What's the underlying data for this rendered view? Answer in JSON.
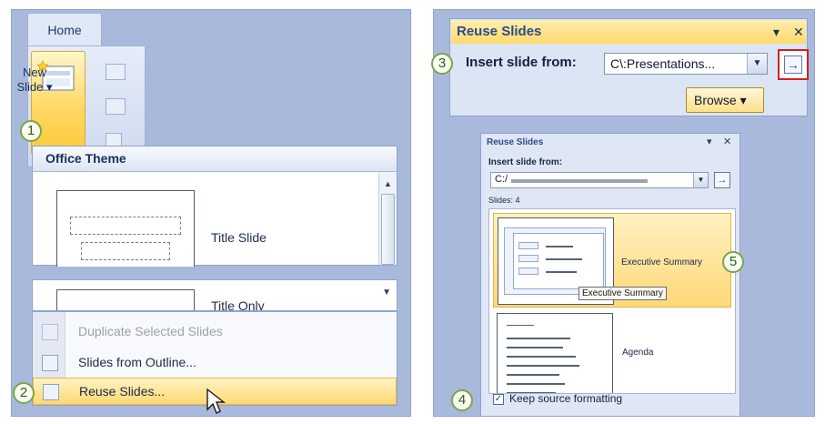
{
  "left": {
    "ribbon": {
      "tab_label": "Home",
      "new_slide_label_1": "New",
      "new_slide_label_2": "Slide ▾"
    },
    "gallery": {
      "header": "Office Theme",
      "layouts": [
        "Title Slide",
        "Title Only"
      ]
    },
    "menu": {
      "items": [
        {
          "label": "Duplicate Selected Slides",
          "state": "disabled"
        },
        {
          "label": "Slides from Outline...",
          "state": "normal"
        },
        {
          "label": "Reuse Slides...",
          "state": "hover"
        }
      ]
    },
    "callouts": [
      "1",
      "2"
    ]
  },
  "right": {
    "pane": {
      "title": "Reuse Slides",
      "dropdown_glyph": "▾",
      "close_glyph": "✕",
      "insert_label": "Insert slide from:",
      "path_value": "C\\:Presentations...",
      "go_glyph": "→",
      "browse_label": "Browse ▾"
    },
    "pane_small": {
      "title": "Reuse Slides",
      "insert_label": "Insert slide from:",
      "path_value": "C:/",
      "slides_count": "Slides: 4",
      "slides": [
        {
          "label": "Executive Summary",
          "selected": true
        },
        {
          "label": "Agenda",
          "selected": false
        }
      ],
      "tooltip": "Executive Summary",
      "keep_label": "Keep source formatting",
      "keep_checked": true
    },
    "callouts": [
      "3",
      "4",
      "5"
    ]
  },
  "colors": {
    "panel_bg": "#a9b9dc",
    "hover_gold": "#ffd872",
    "callout_green": "#79a744",
    "go_highlight": "#d42020"
  }
}
